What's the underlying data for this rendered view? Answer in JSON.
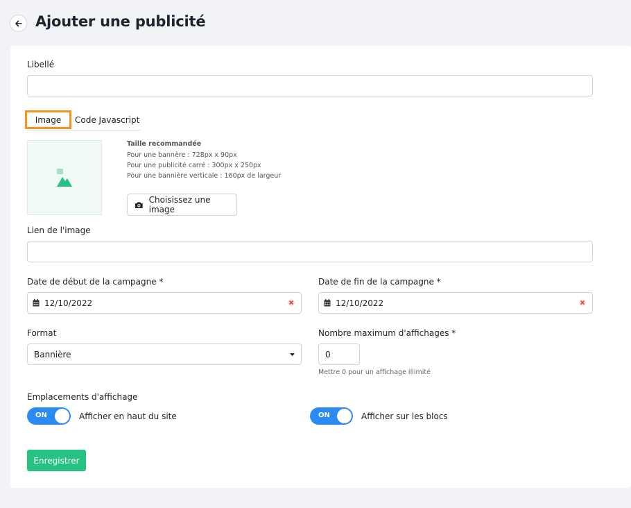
{
  "header": {
    "title": "Ajouter une publicité",
    "back_icon": "arrow-left-icon"
  },
  "form": {
    "libelle_label": "Libellé",
    "libelle_value": "",
    "tabs": [
      {
        "label": "Image",
        "active": true
      },
      {
        "label": "Code Javascript",
        "active": false
      }
    ],
    "size_info": {
      "title": "Taille recommandée",
      "lines": [
        "Pour une bannère : 728px x 90px",
        "Pour une publicité carré : 300px x 250px",
        "Pour une bannière verticale : 160px de largeur"
      ]
    },
    "choose_image_label": "Choisissez une image",
    "image_link_label": "Lien de l'image",
    "image_link_value": "",
    "start_date_label": "Date de début de la campagne *",
    "start_date_value": "12/10/2022",
    "end_date_label": "Date de fin de la campagne *",
    "end_date_value": "12/10/2022",
    "format_label": "Format",
    "format_value": "Bannière",
    "max_display_label": "Nombre maximum d'affichages *",
    "max_display_value": "0",
    "max_display_hint": "Mettre 0 pour un affichage illimité",
    "placements_label": "Emplacements d'affichage",
    "toggles": [
      {
        "state_label": "ON",
        "label": "Afficher en haut du site",
        "on": true
      },
      {
        "state_label": "ON",
        "label": "Afficher sur les blocs",
        "on": true
      }
    ],
    "save_label": "Enregistrer"
  },
  "colors": {
    "accent_green": "#26c281",
    "toggle_blue": "#2b8bf2",
    "tab_highlight": "#f7941d",
    "clear_red": "#e0463c"
  }
}
